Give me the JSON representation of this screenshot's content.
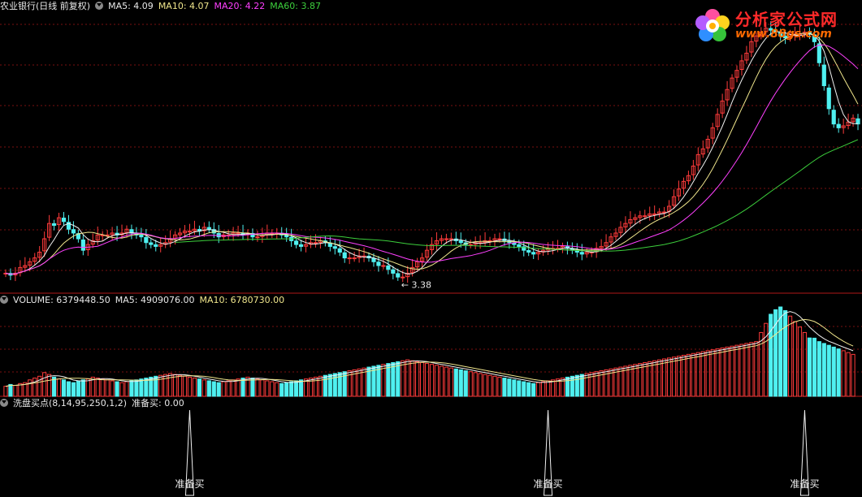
{
  "header": {
    "stock_name": "农业银行(日线 前复权)",
    "ma5": "MA5: 4.09",
    "ma10": "MA10: 4.07",
    "ma20": "MA20: 4.22",
    "ma60": "MA60: 3.87"
  },
  "volume_header": {
    "volume": "VOLUME: 6379448.50",
    "ma5": "MA5: 4909076.00",
    "ma10": "MA10: 6780730.00"
  },
  "indicator_header": {
    "name": "洗盘买点(8,14,95,250,1,2)",
    "value": "准备买: 0.00"
  },
  "logo": {
    "brand": "分析家公式网",
    "url": "www.88gs.com"
  },
  "colors": {
    "up": "#ff3b3b",
    "down": "#4ff0f0",
    "ma5": "#f0f0f0",
    "ma10": "#f0e68c",
    "ma20": "#ff40ff",
    "ma60": "#3ccf3c",
    "grid": "#7a1010",
    "divider": "#b01818"
  },
  "chart_data": [
    {
      "type": "candlestick",
      "panel": "price",
      "series_name": "农业银行",
      "annotation_low": "3.38",
      "axis_visible": false,
      "grid": true,
      "x": [
        1,
        2,
        3,
        4,
        5,
        6,
        7,
        8,
        9,
        10,
        11,
        12,
        13,
        14,
        15,
        16,
        17,
        18,
        19,
        20,
        21,
        22,
        23,
        24,
        25,
        26,
        27,
        28,
        29,
        30,
        31,
        32,
        33,
        34,
        35,
        36,
        37,
        38,
        39,
        40,
        41,
        42,
        43,
        44,
        45,
        46,
        47,
        48,
        49,
        50,
        51,
        52,
        53,
        54,
        55,
        56,
        57,
        58,
        59,
        60,
        61,
        62,
        63,
        64,
        65,
        66,
        67,
        68,
        69,
        70,
        71,
        72,
        73,
        74,
        75,
        76,
        77,
        78,
        79,
        80,
        81,
        82,
        83,
        84,
        85,
        86,
        87,
        88,
        89,
        90,
        91,
        92,
        93,
        94,
        95,
        96,
        97,
        98,
        99,
        100,
        101,
        102,
        103,
        104,
        105,
        106,
        107,
        108,
        109,
        110,
        111,
        112,
        113,
        114,
        115,
        116,
        117,
        118,
        119,
        120,
        121,
        122,
        123,
        124,
        125,
        126,
        127,
        128,
        129,
        130,
        131,
        132,
        133,
        134,
        135,
        136,
        137,
        138,
        139,
        140,
        141,
        142,
        143,
        144,
        145,
        146,
        147,
        148,
        149,
        150,
        151,
        152,
        153,
        154,
        155,
        156,
        157,
        158,
        159,
        160,
        161,
        162,
        163,
        164,
        165,
        166,
        167,
        168,
        169,
        170,
        171,
        172,
        173,
        174,
        175
      ],
      "close": [
        3.52,
        3.51,
        3.52,
        3.55,
        3.56,
        3.58,
        3.6,
        3.63,
        3.7,
        3.78,
        3.77,
        3.81,
        3.79,
        3.75,
        3.73,
        3.7,
        3.64,
        3.67,
        3.69,
        3.72,
        3.72,
        3.72,
        3.73,
        3.72,
        3.73,
        3.75,
        3.73,
        3.72,
        3.71,
        3.68,
        3.67,
        3.66,
        3.67,
        3.68,
        3.7,
        3.72,
        3.73,
        3.74,
        3.74,
        3.75,
        3.74,
        3.76,
        3.75,
        3.73,
        3.71,
        3.72,
        3.72,
        3.73,
        3.73,
        3.72,
        3.73,
        3.71,
        3.71,
        3.72,
        3.73,
        3.73,
        3.73,
        3.72,
        3.71,
        3.69,
        3.67,
        3.66,
        3.67,
        3.68,
        3.68,
        3.69,
        3.68,
        3.66,
        3.65,
        3.63,
        3.6,
        3.6,
        3.6,
        3.61,
        3.61,
        3.6,
        3.58,
        3.56,
        3.56,
        3.54,
        3.52,
        3.5,
        3.5,
        3.52,
        3.55,
        3.58,
        3.6,
        3.64,
        3.67,
        3.69,
        3.7,
        3.7,
        3.7,
        3.69,
        3.68,
        3.67,
        3.67,
        3.68,
        3.68,
        3.69,
        3.69,
        3.7,
        3.7,
        3.69,
        3.68,
        3.67,
        3.66,
        3.64,
        3.63,
        3.62,
        3.63,
        3.64,
        3.65,
        3.65,
        3.65,
        3.66,
        3.65,
        3.64,
        3.63,
        3.62,
        3.63,
        3.63,
        3.65,
        3.66,
        3.68,
        3.71,
        3.73,
        3.76,
        3.78,
        3.8,
        3.81,
        3.82,
        3.82,
        3.83,
        3.83,
        3.84,
        3.84,
        3.87,
        3.92,
        3.96,
        4.0,
        4.03,
        4.08,
        4.14,
        4.17,
        4.22,
        4.28,
        4.35,
        4.42,
        4.48,
        4.54,
        4.58,
        4.63,
        4.67,
        4.73,
        4.76,
        4.78,
        4.8,
        4.79,
        4.78,
        4.76,
        4.75,
        4.76,
        4.77,
        4.77,
        4.78,
        4.77,
        4.73,
        4.62,
        4.5,
        4.38,
        4.3,
        4.28,
        4.29,
        4.31,
        4.33,
        4.3
      ],
      "values_are_estimates": true,
      "ma_series": [
        {
          "name": "MA5",
          "value": "4.09"
        },
        {
          "name": "MA10",
          "value": "4.07"
        },
        {
          "name": "MA20",
          "value": "4.22"
        },
        {
          "name": "MA60",
          "value": "3.87"
        }
      ]
    },
    {
      "type": "bar",
      "panel": "volume",
      "series_name": "VOLUME",
      "values_are_estimates": true,
      "volume": [
        1100000,
        1300000,
        1200000,
        1400000,
        1500000,
        1800000,
        2000000,
        2200000,
        2600000,
        2400000,
        2100000,
        1900000,
        1800000,
        1600000,
        1500000,
        1700000,
        1800000,
        1900000,
        2100000,
        2000000,
        1900000,
        1800000,
        1700000,
        1600000,
        1500000,
        1600000,
        1700000,
        1800000,
        1900000,
        2000000,
        2100000,
        2200000,
        2300000,
        2400000,
        2500000,
        2400000,
        2300000,
        2200000,
        2100000,
        2000000,
        1900000,
        1800000,
        1700000,
        1600000,
        1500000,
        1600000,
        1700000,
        1800000,
        1900000,
        2000000,
        2100000,
        2000000,
        1900000,
        1800000,
        1700000,
        1600000,
        1500000,
        1400000,
        1500000,
        1600000,
        1700000,
        1800000,
        1900000,
        2000000,
        2100000,
        2200000,
        2300000,
        2400000,
        2500000,
        2600000,
        2700000,
        2800000,
        2900000,
        3000000,
        3100000,
        3200000,
        3300000,
        3400000,
        3500000,
        3600000,
        3700000,
        3800000,
        3900000,
        4000000,
        3900000,
        3800000,
        3700000,
        3600000,
        3500000,
        3400000,
        3300000,
        3200000,
        3100000,
        3000000,
        2900000,
        2800000,
        2700000,
        2600000,
        2500000,
        2400000,
        2300000,
        2200000,
        2100000,
        2000000,
        1900000,
        1800000,
        1700000,
        1600000,
        1500000,
        1400000,
        1500000,
        1600000,
        1700000,
        1800000,
        1900000,
        2000000,
        2100000,
        2200000,
        2300000,
        2400000,
        2500000,
        2600000,
        2700000,
        2800000,
        2900000,
        3000000,
        3100000,
        3200000,
        3300000,
        3400000,
        3500000,
        3600000,
        3700000,
        3800000,
        3900000,
        4000000,
        4100000,
        4200000,
        4300000,
        4400000,
        4500000,
        4600000,
        4700000,
        4800000,
        4900000,
        5000000,
        5100000,
        5200000,
        5300000,
        5400000,
        5500000,
        5600000,
        5700000,
        5800000,
        5900000,
        6000000,
        7000000,
        8000000,
        9000000,
        9500000,
        9800000,
        9400000,
        8800000,
        8200000,
        7600000,
        7000000,
        6400000,
        6379448,
        6000000,
        5800000,
        5600000,
        5400000,
        5200000,
        5000000,
        4800000,
        4600000
      ],
      "ma5": "4909076.00",
      "ma10": "6780730.00"
    },
    {
      "type": "line",
      "panel": "indicator",
      "series_name": "准备买",
      "signal_positions": [
        38,
        112,
        165
      ],
      "signal_label": "准备买",
      "current_value": "0.00"
    }
  ]
}
